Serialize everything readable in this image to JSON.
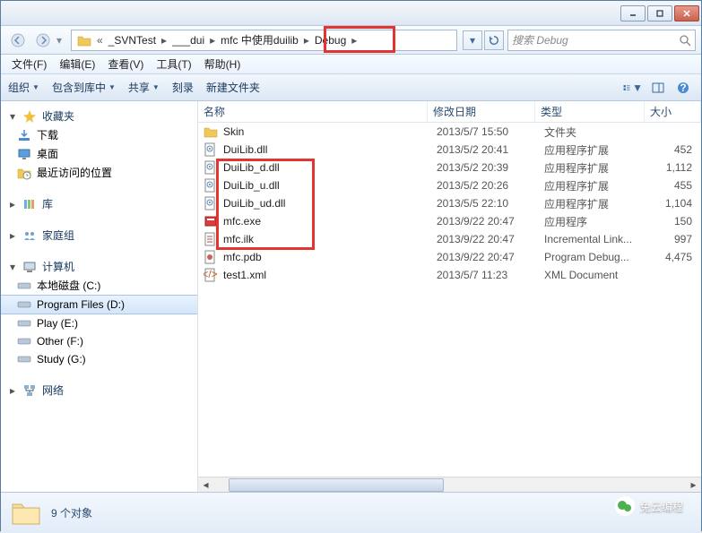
{
  "titlebar": {
    "min_tip": "最小化",
    "max_tip": "最大化",
    "close_tip": "关闭"
  },
  "breadcrumb": {
    "segments": [
      "_SVNTest",
      "___dui",
      "mfc 中使用duilib",
      "Debug"
    ]
  },
  "search": {
    "placeholder": "搜索 Debug"
  },
  "menubar": {
    "items": [
      "文件(F)",
      "编辑(E)",
      "查看(V)",
      "工具(T)",
      "帮助(H)"
    ]
  },
  "toolbar": {
    "organize": "组织",
    "include": "包含到库中",
    "share": "共享",
    "burn": "刻录",
    "newfolder": "新建文件夹"
  },
  "sidebar": {
    "favorites": {
      "label": "收藏夹",
      "items": [
        "下载",
        "桌面",
        "最近访问的位置"
      ]
    },
    "libraries": {
      "label": "库"
    },
    "homegroup": {
      "label": "家庭组"
    },
    "computer": {
      "label": "计算机",
      "drives": [
        "本地磁盘 (C:)",
        "Program Files (D:)",
        "Play (E:)",
        "Other (F:)",
        "Study (G:)"
      ]
    },
    "network": {
      "label": "网络"
    }
  },
  "columns": {
    "name": "名称",
    "date": "修改日期",
    "type": "类型",
    "size": "大小"
  },
  "files": [
    {
      "icon": "folder",
      "name": "Skin",
      "date": "2013/5/7 15:50",
      "type": "文件夹",
      "size": ""
    },
    {
      "icon": "dll",
      "name": "DuiLib.dll",
      "date": "2013/5/2 20:41",
      "type": "应用程序扩展",
      "size": "452"
    },
    {
      "icon": "dll",
      "name": "DuiLib_d.dll",
      "date": "2013/5/2 20:39",
      "type": "应用程序扩展",
      "size": "1,112"
    },
    {
      "icon": "dll",
      "name": "DuiLib_u.dll",
      "date": "2013/5/2 20:26",
      "type": "应用程序扩展",
      "size": "455"
    },
    {
      "icon": "dll",
      "name": "DuiLib_ud.dll",
      "date": "2013/5/5 22:10",
      "type": "应用程序扩展",
      "size": "1,104"
    },
    {
      "icon": "exe",
      "name": "mfc.exe",
      "date": "2013/9/22 20:47",
      "type": "应用程序",
      "size": "150"
    },
    {
      "icon": "ilk",
      "name": "mfc.ilk",
      "date": "2013/9/22 20:47",
      "type": "Incremental Link...",
      "size": "997"
    },
    {
      "icon": "pdb",
      "name": "mfc.pdb",
      "date": "2013/9/22 20:47",
      "type": "Program Debug...",
      "size": "4,475"
    },
    {
      "icon": "xml",
      "name": "test1.xml",
      "date": "2013/5/7 11:23",
      "type": "XML Document",
      "size": ""
    }
  ],
  "status": {
    "count": "9 个对象"
  },
  "watermark": "兔云编程"
}
